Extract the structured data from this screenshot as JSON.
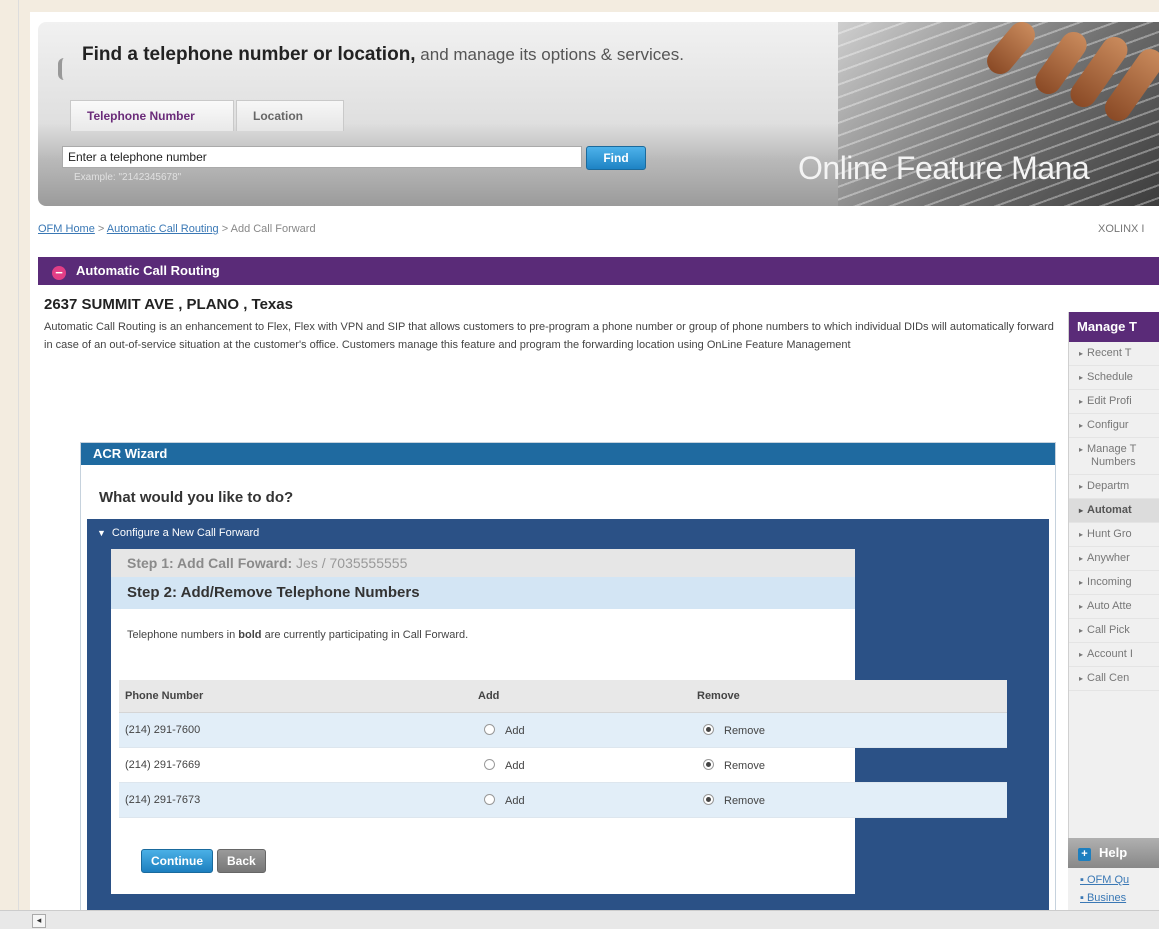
{
  "hero": {
    "title_bold": "Find a telephone number or location,",
    "title_rest": " and manage its options & services.",
    "tabs": [
      "Telephone Number",
      "Location"
    ],
    "search_value": "Enter a telephone number",
    "find_label": "Find",
    "example": "Example: \"2142345678\"",
    "banner_title": "Online Feature Mana"
  },
  "breadcrumb": {
    "home": "OFM Home",
    "sep1": " > ",
    "acr": "Automatic Call Routing",
    "sep2": " > ",
    "current": "Add Call Forward"
  },
  "user": "XOLINX I",
  "acr": {
    "header": "Automatic Call Routing",
    "address": "2637 SUMMIT AVE , PLANO , Texas",
    "description": "Automatic Call Routing is an enhancement to Flex, Flex with VPN and SIP that allows customers to pre-program a phone number or group of phone numbers to which individual DIDs will automatically forward in case of an out-of-service situation at the customer's office. Customers manage this feature and program the forwarding location using OnLine Feature Management"
  },
  "wizard": {
    "title": "ACR Wizard",
    "question": "What would you like to do?",
    "config_label": "Configure a New Call Forward",
    "step1_label": "Step 1: Add Call Foward:",
    "step1_value": " Jes / 7035555555",
    "step2_label": "Step 2: Add/Remove Telephone Numbers",
    "note_pre": "Telephone numbers in ",
    "note_bold": "bold",
    "note_post": " are currently participating in Call Forward.",
    "columns": [
      "Phone Number",
      "Add",
      "Remove"
    ],
    "rows": [
      {
        "phone": "(214) 291-7600",
        "add": "Add",
        "remove": "Remove"
      },
      {
        "phone": "(214) 291-7669",
        "add": "Add",
        "remove": "Remove"
      },
      {
        "phone": "(214) 291-7673",
        "add": "Add",
        "remove": "Remove"
      }
    ],
    "continue_label": "Continue",
    "back_label": "Back"
  },
  "manage": {
    "title": "Manage T",
    "items": [
      "Recent T",
      "Schedule",
      "Edit Profi",
      "Configur",
      "Manage T",
      "Numbers",
      "Departm",
      "Automat",
      "Hunt Gro",
      "Anywher",
      "Incoming",
      "Auto Atte",
      "Call Pick",
      "Account I",
      "Call Cen"
    ]
  },
  "help": {
    "title": "Help",
    "items": [
      "OFM Qu",
      "Busines"
    ]
  }
}
